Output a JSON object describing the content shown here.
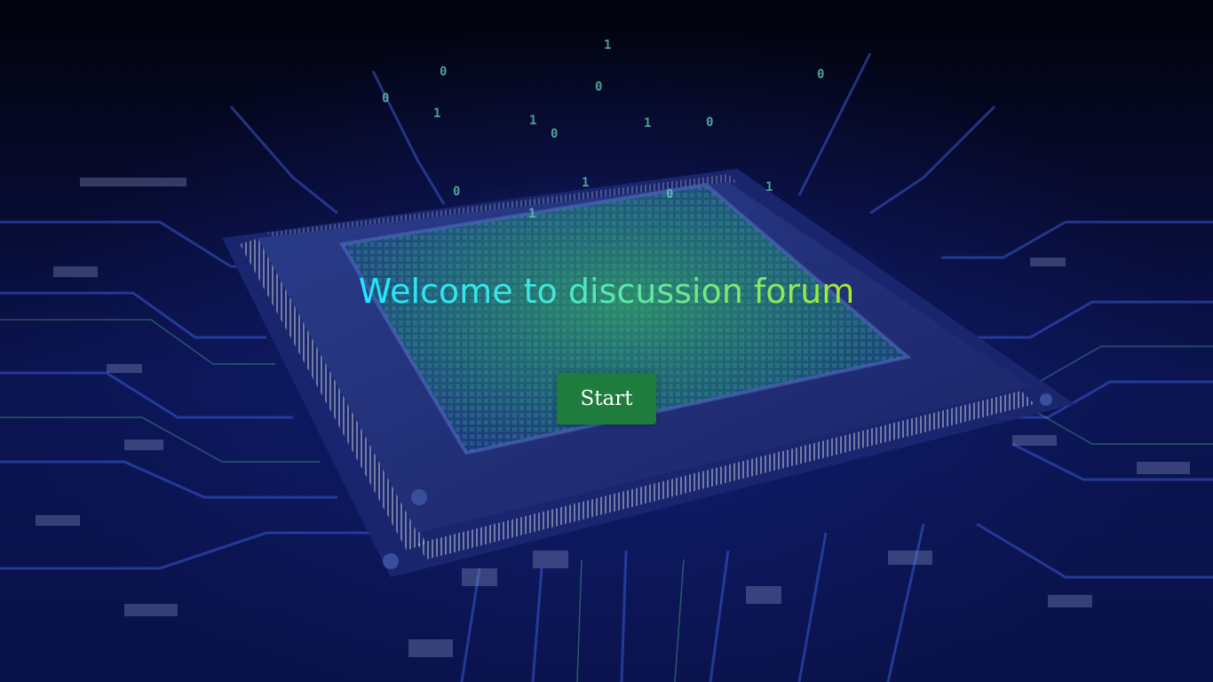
{
  "hero": {
    "title": "Welcome to discussion forum",
    "title_gradient": [
      "#22e6ff",
      "#a6ea2e"
    ]
  },
  "actions": {
    "start_label": "Start",
    "start_color": "#1e7d3c"
  },
  "background": {
    "theme": "circuit-board-cpu",
    "binary_digits": [
      "0",
      "1",
      "1",
      "0",
      "1",
      "0",
      "0",
      "1",
      "0",
      "1",
      "0",
      "1",
      "0",
      "0",
      "1"
    ]
  }
}
